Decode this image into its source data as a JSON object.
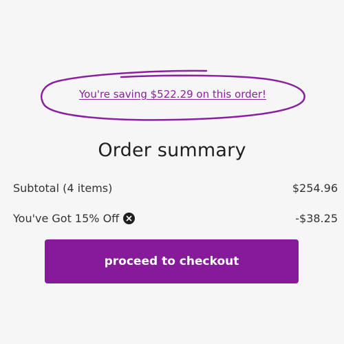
{
  "savings": {
    "message": "You're saving $522.29 on this order!"
  },
  "summary": {
    "title": "Order summary",
    "subtotal_label": "Subtotal (4 items)",
    "subtotal_value": "$254.96",
    "discount_label": "You've Got 15% Off",
    "discount_value": "-$38.25",
    "remove_discount_icon": "x-circle-icon"
  },
  "checkout": {
    "button_label": "proceed to checkout"
  },
  "colors": {
    "accent": "#871a9b",
    "link": "#8a1fa0",
    "background": "#f6f6f6"
  }
}
